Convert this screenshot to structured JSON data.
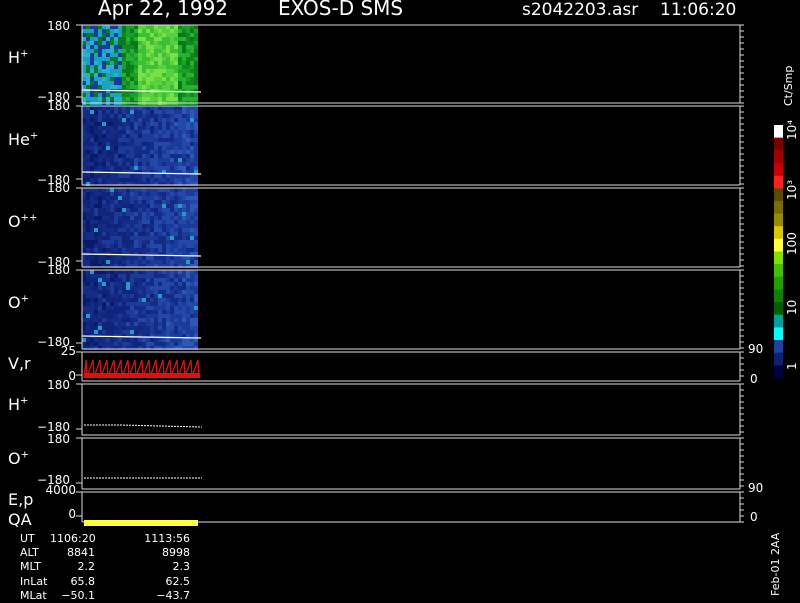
{
  "header": {
    "date": "Apr 22, 1992",
    "mission": "EXOS-D SMS",
    "file": "s2042203.asr",
    "time": "11:06:20"
  },
  "panels": [
    {
      "species": "H",
      "charge": "+",
      "top": "180",
      "bottom": "−180"
    },
    {
      "species": "He",
      "charge": "+",
      "top": "180",
      "bottom": "−180"
    },
    {
      "species": "O",
      "charge": "++",
      "top": "180",
      "bottom": "−180"
    },
    {
      "species": "O",
      "charge": "+",
      "top": "180",
      "bottom": "−180"
    }
  ],
  "vr_panel": {
    "label": "V,r",
    "left_top": "25",
    "left_bottom": "0",
    "right_top": "90",
    "right_bottom": "0"
  },
  "h_lower": {
    "species": "H",
    "charge": "+",
    "top": "180",
    "bottom": "−180"
  },
  "o_lower": {
    "species": "O",
    "charge": "+",
    "top": "180",
    "bottom": "−180"
  },
  "ep_panel": {
    "label": "E,p",
    "left_top": "4000",
    "right_top": "90"
  },
  "qa_panel": {
    "label": "QA",
    "left_bottom": "0",
    "right_bottom": "0"
  },
  "colorbar": {
    "unit": "Ct/Smp",
    "ticks": [
      "10⁴",
      "10³",
      "100",
      "10",
      "1"
    ],
    "colors": [
      "#ffffff",
      "#7a0000",
      "#a00000",
      "#c80000",
      "#ff2020",
      "#5a4a00",
      "#7a6a00",
      "#9a8a00",
      "#d8c800",
      "#ffff40",
      "#80e000",
      "#40c000",
      "#20a000",
      "#108000",
      "#006000",
      "#00a0a0",
      "#00ffff",
      "#2040a0",
      "#102070",
      "#000040"
    ]
  },
  "info": {
    "labels": [
      "UT",
      "ALT",
      "MLT",
      "InLat",
      "MLat"
    ],
    "col1": [
      "1106:20",
      "8841",
      "2.2",
      "65.8",
      "−50.1"
    ],
    "col2": [
      "1113:56",
      "8998",
      "2.3",
      "62.5",
      "−43.7"
    ]
  },
  "footer": {
    "stamp": "Feb-01 2AA"
  },
  "chart_data": {
    "type": "heatmap",
    "title": "Apr 22, 1992   EXOS-D SMS",
    "time_range": [
      "1106:20",
      "1113:56"
    ],
    "ylim": [
      -180,
      180
    ],
    "colorscale": "log",
    "colorbar_unit": "Ct/Smp",
    "colorbar_range": [
      1,
      10000
    ],
    "series": [
      {
        "name": "H+",
        "dominant_color": "green",
        "approx_counts": 30
      },
      {
        "name": "He+",
        "dominant_color": "dark blue",
        "approx_counts": 2
      },
      {
        "name": "O++",
        "dominant_color": "dark blue",
        "approx_counts": 2
      },
      {
        "name": "O+",
        "dominant_color": "dark blue",
        "approx_counts": 3
      }
    ]
  }
}
